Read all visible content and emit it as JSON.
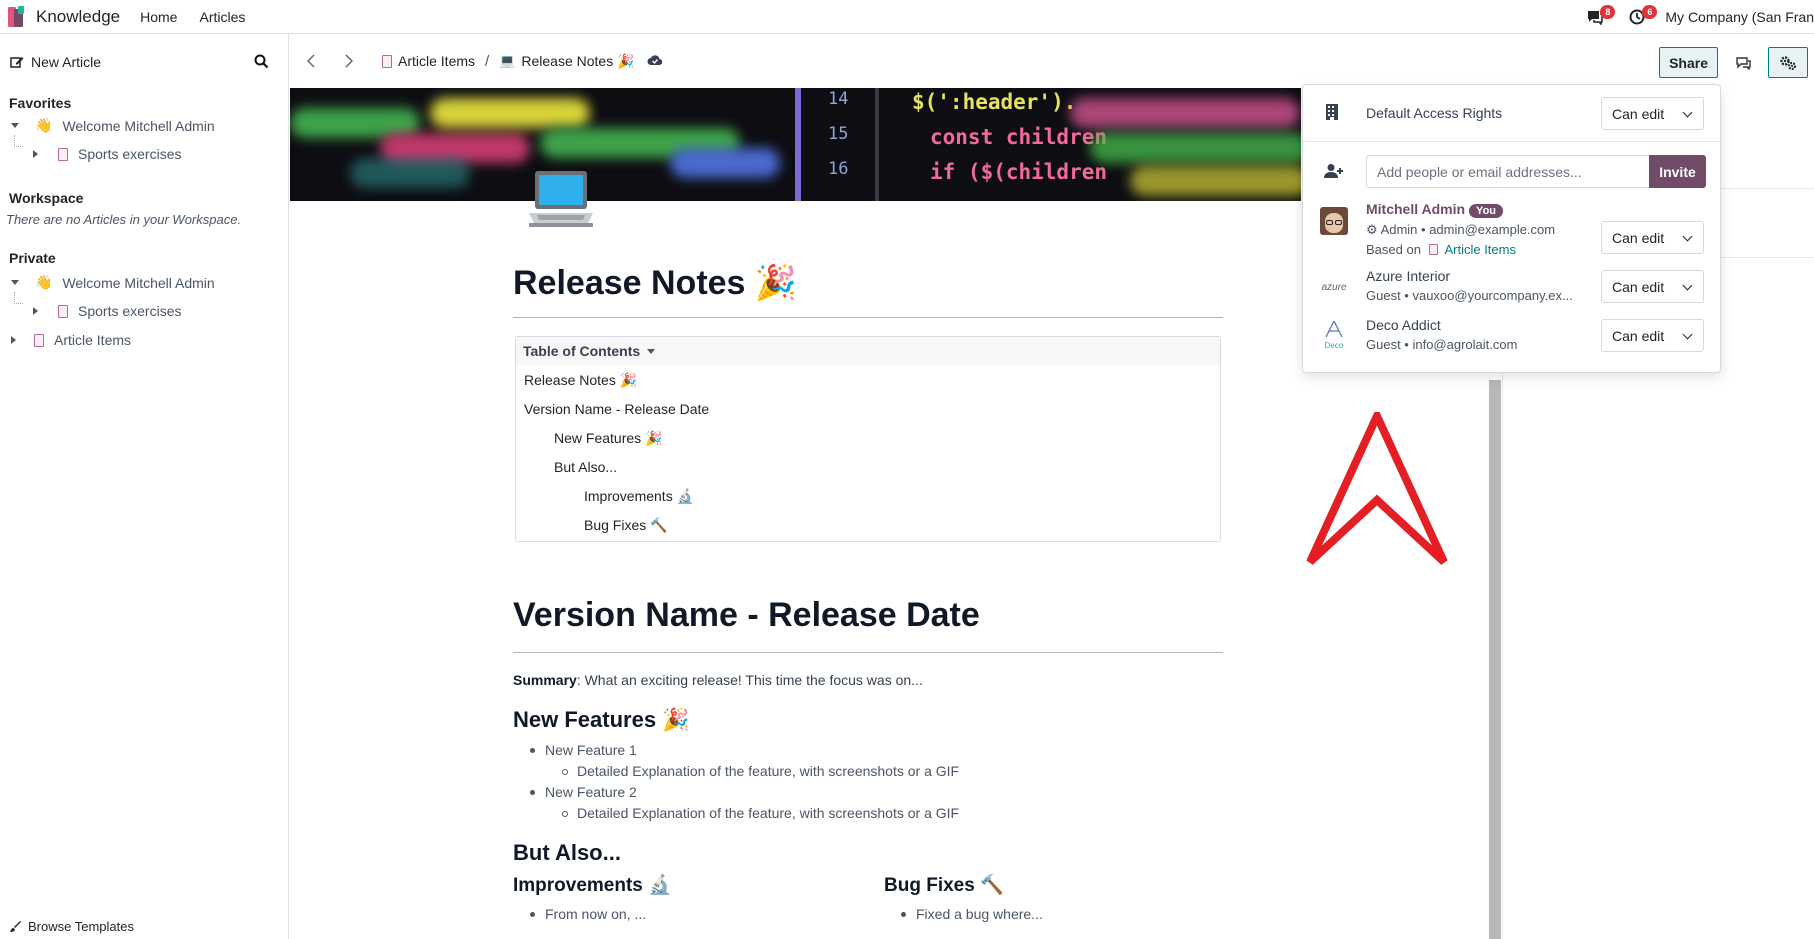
{
  "navbar": {
    "app_name": "Knowledge",
    "menu": [
      "Home",
      "Articles"
    ],
    "messages_count": "8",
    "activities_count": "6",
    "company": "My Company (San Fran"
  },
  "sidebar": {
    "new_article": "New Article",
    "favorites_title": "Favorites",
    "favorites": [
      {
        "label": "Welcome Mitchell Admin",
        "emoji": "👋"
      },
      {
        "label": "Sports exercises"
      }
    ],
    "workspace_title": "Workspace",
    "workspace_empty": "There are no Articles in your Workspace.",
    "private_title": "Private",
    "private": [
      {
        "label": "Welcome Mitchell Admin",
        "emoji": "👋"
      },
      {
        "label": "Sports exercises"
      },
      {
        "label": "Article Items"
      }
    ],
    "browse_templates": "Browse Templates"
  },
  "breadcrumb": {
    "parent": "Article Items",
    "current": "Release Notes 🎉"
  },
  "toolbar": {
    "share_label": "Share"
  },
  "article": {
    "icon": "💻",
    "title": "Release Notes 🎉",
    "toc_title": "Table of Contents",
    "toc": [
      {
        "label": "Release Notes 🎉"
      },
      {
        "label": "Version Name - Release Date"
      },
      {
        "label": "New Features 🎉"
      },
      {
        "label": "But Also..."
      },
      {
        "label": "Improvements 🔬"
      },
      {
        "label": "Bug Fixes 🔨"
      }
    ],
    "version_heading": "Version Name - Release Date",
    "summary_label": "Summary",
    "summary_text": ": What an exciting release! This time the focus was on...",
    "new_features_heading": "New Features 🎉",
    "features": [
      {
        "label": "New Feature 1",
        "detail": "Detailed Explanation of the feature, with screenshots or a GIF"
      },
      {
        "label": "New Feature 2",
        "detail": "Detailed Explanation of the feature, with screenshots or a GIF"
      }
    ],
    "but_also_heading": "But Also...",
    "improvements_heading": "Improvements 🔬",
    "improvements_item": "From now on, ...",
    "bugfixes_heading": "Bug Fixes 🔨",
    "bugfixes_item": "Fixed a bug where..."
  },
  "share_panel": {
    "default_access_label": "Default Access Rights",
    "default_access_value": "Can edit",
    "invite_placeholder": "Add people or email addresses...",
    "invite_button": "Invite",
    "members": [
      {
        "name": "Mitchell Admin",
        "badge": "You",
        "role": "Admin",
        "email": "admin@example.com",
        "based_on_label": "Based on",
        "based_on_article": "Article Items",
        "permission": "Can edit"
      },
      {
        "name": "Azure Interior",
        "logo_text": "azure",
        "role": "Guest",
        "email": "vauxoo@yourcompany.ex...",
        "permission": "Can edit"
      },
      {
        "name": "Deco Addict",
        "logo_text": "Deco",
        "role": "Guest",
        "email": "info@agrolait.com",
        "permission": "Can edit"
      }
    ]
  },
  "cover": {
    "line_numbers": [
      "14",
      "15",
      "16"
    ],
    "code_lines": [
      "$(':header').",
      "const children",
      "if ($(children"
    ]
  },
  "colors": {
    "brand": "#714b67",
    "accent": "#017e84",
    "badge": "#e2333b",
    "overlay_arrow": "#e31e24"
  }
}
